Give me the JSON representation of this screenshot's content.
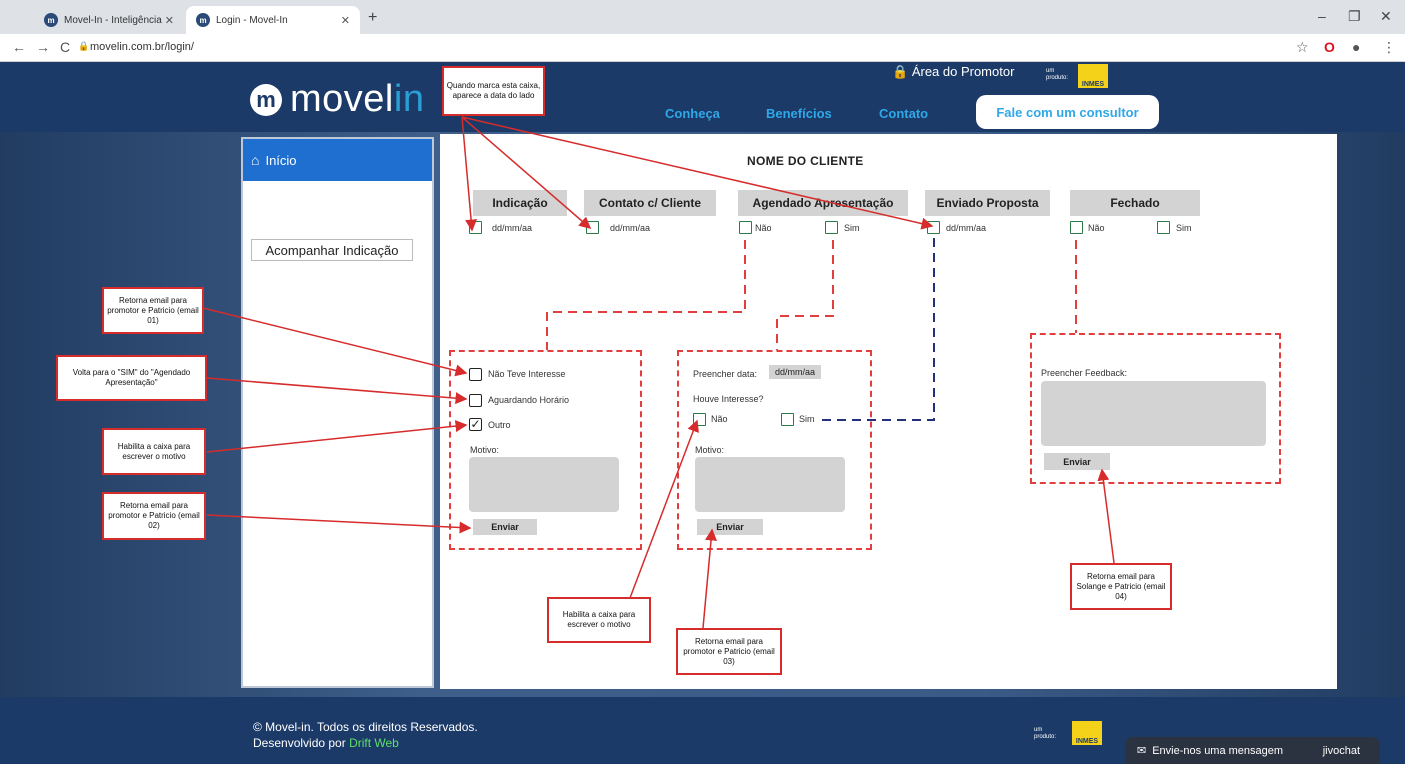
{
  "browser": {
    "tabs": [
      {
        "title": "Movel-In - Inteligência e tecnolo",
        "active": false
      },
      {
        "title": "Login - Movel-In",
        "active": true
      }
    ],
    "url": "movelin.com.br/login/"
  },
  "header": {
    "logo_text": "movel",
    "logo_accent": "in",
    "nav": [
      "Conheça",
      "Benefícios",
      "Contato"
    ],
    "cta": "Fale com um consultor",
    "promotor": "Área do Promotor",
    "produto_label": "um produto:",
    "brand": "INMES"
  },
  "sidebar": {
    "inicio": "Início",
    "acompanhar": "Acompanhar Indicação"
  },
  "main": {
    "cliente": "NOME DO CLIENTE",
    "stages": [
      "Indicação",
      "Contato c/ Cliente",
      "Agendado Apresentação",
      "Enviado Proposta",
      "Fechado"
    ],
    "date_placeholder": "dd/mm/aa",
    "nao": "Não",
    "sim": "Sim",
    "box1": {
      "opt1": "Não Teve Interesse",
      "opt2": "Aguardando Horário",
      "opt3": "Outro",
      "motivo": "Motivo:",
      "enviar": "Enviar"
    },
    "box2": {
      "preencher_data": "Preencher data:",
      "date": "dd/mm/aa",
      "houve": "Houve Interesse?",
      "motivo": "Motivo:",
      "enviar": "Enviar"
    },
    "box3": {
      "feedback": "Preencher Feedback:",
      "enviar": "Enviar"
    }
  },
  "notes": {
    "n1": "Quando marca esta caixa, aparece a data do lado",
    "n2": "Retorna email para promotor e Patricio (email 01)",
    "n3": "Volta para o \"SIM\" do \"Agendado Apresentação\"",
    "n4": "Habilita a caixa para escrever o motivo",
    "n5": "Retorna email para promotor e Patricio (email 02)",
    "n6": "Habilita a caixa para escrever o motivo",
    "n7": "Retorna email para promotor e Patricio (email 03)",
    "n8": "Retorna email para Solange e Patricio (email 04)"
  },
  "footer": {
    "copyright": "© Movel-in. Todos os direitos Reservados.",
    "dev_prefix": "Desenvolvido por ",
    "dev_name": "Drift Web",
    "chat": "Envie-nos uma mensagem",
    "chat_brand": "jivochat"
  }
}
